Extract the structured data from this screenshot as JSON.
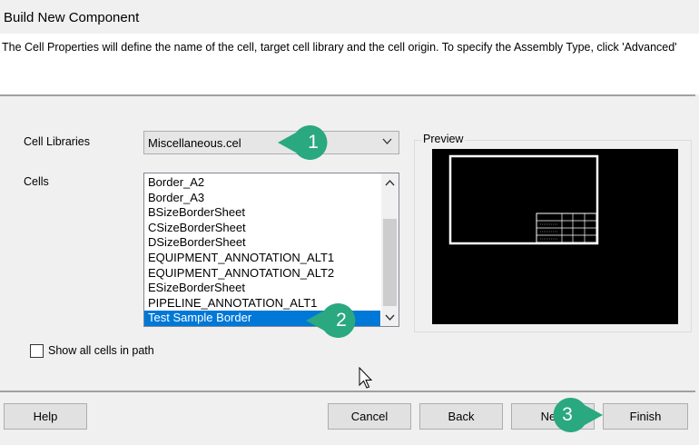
{
  "window": {
    "title": "Build New Component"
  },
  "header": {
    "description": "The Cell Properties will define the name of the cell, target cell library and the cell origin.  To specify the Assembly Type, click 'Advanced'"
  },
  "form": {
    "cell_libraries_label": "Cell Libraries",
    "cell_libraries_value": "Miscellaneous.cel",
    "cells_label": "Cells",
    "cells": [
      "Border_A2",
      "Border_A3",
      "BSizeBorderSheet",
      "CSizeBorderSheet",
      "DSizeBorderSheet",
      "EQUIPMENT_ANNOTATION_ALT1",
      "EQUIPMENT_ANNOTATION_ALT2",
      "ESizeBorderSheet",
      "PIPELINE_ANNOTATION_ALT1",
      "Test Sample Border"
    ],
    "selected_cell": "Test Sample Border",
    "show_all_label": "Show all cells in path",
    "show_all_checked": false
  },
  "preview": {
    "label": "Preview"
  },
  "buttons": {
    "help": "Help",
    "cancel": "Cancel",
    "back": "Back",
    "next": "Next",
    "finish": "Finish"
  },
  "callouts": [
    "1",
    "2",
    "3"
  ],
  "colors": {
    "callout": "#2aa87f",
    "selection": "#0078d7"
  },
  "icons": {
    "combo_arrow": "chevron-down-icon",
    "cursor": "mouse-pointer-icon"
  }
}
